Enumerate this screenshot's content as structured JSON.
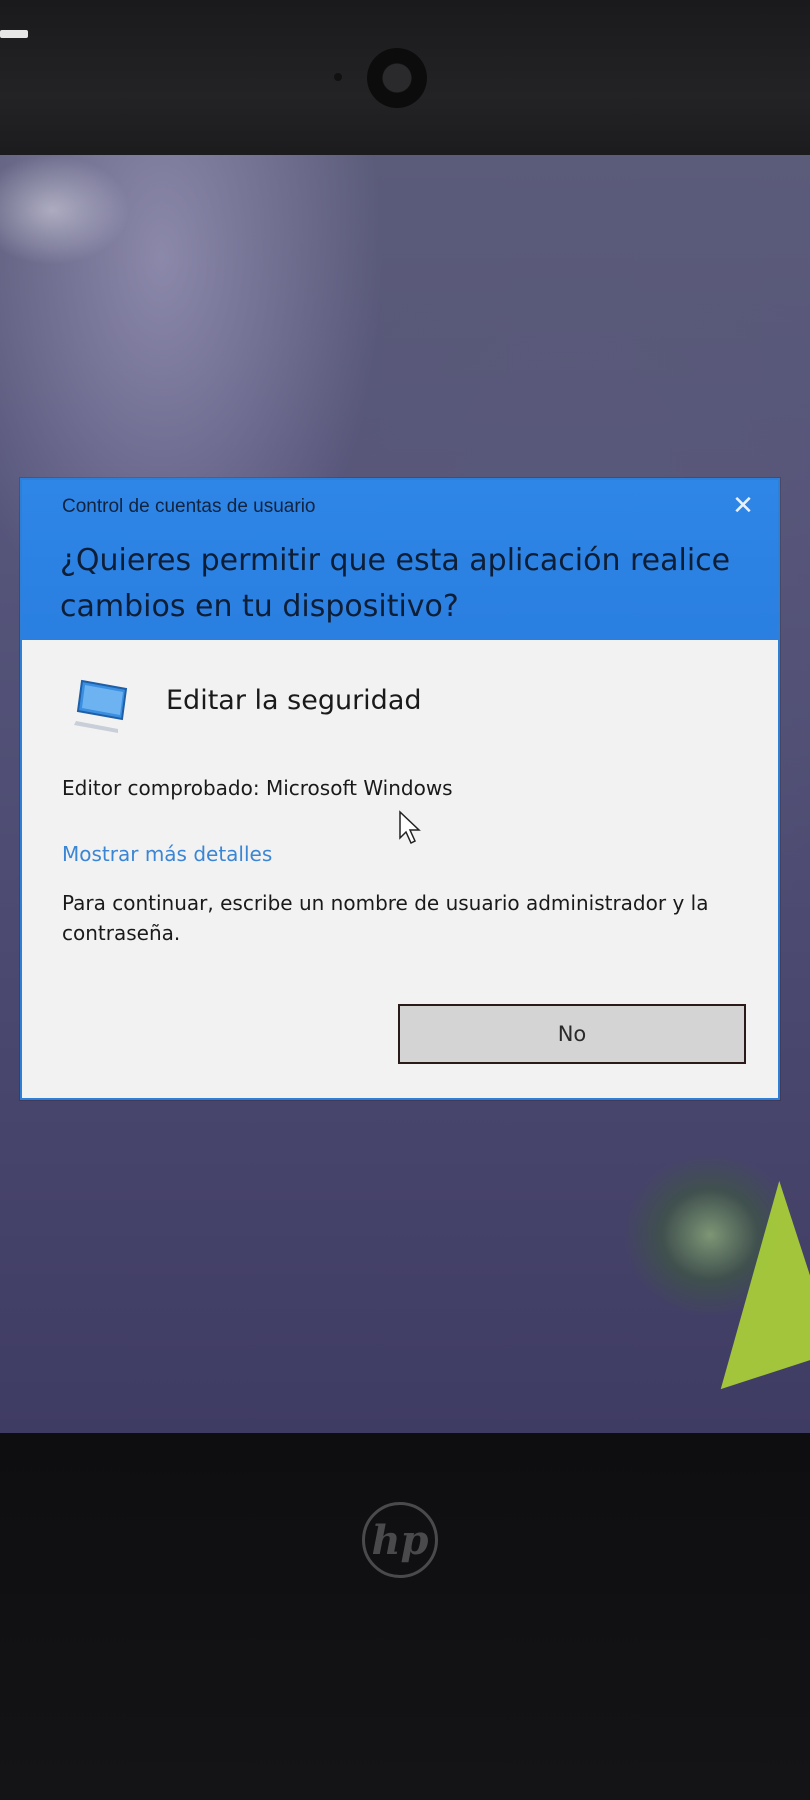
{
  "dialog": {
    "caption": "Control de cuentas de usuario",
    "close_glyph": "✕",
    "question": "¿Quieres permitir que esta aplicación realice cambios en tu dispositivo?",
    "app_name": "Editar la seguridad",
    "app_icon": "monitor-icon",
    "publisher": "Editor comprobado: Microsoft Windows",
    "details_link": "Mostrar más detalles",
    "instructions": "Para continuar, escribe un nombre de usuario administrador y la contraseña.",
    "no_button": "No"
  },
  "device": {
    "logo_text": "hp"
  },
  "colors": {
    "header_blue": "#2e86e6",
    "link_blue": "#3a86d4",
    "dialog_body": "#f2f2f2",
    "desktop": "#4e4c72"
  }
}
